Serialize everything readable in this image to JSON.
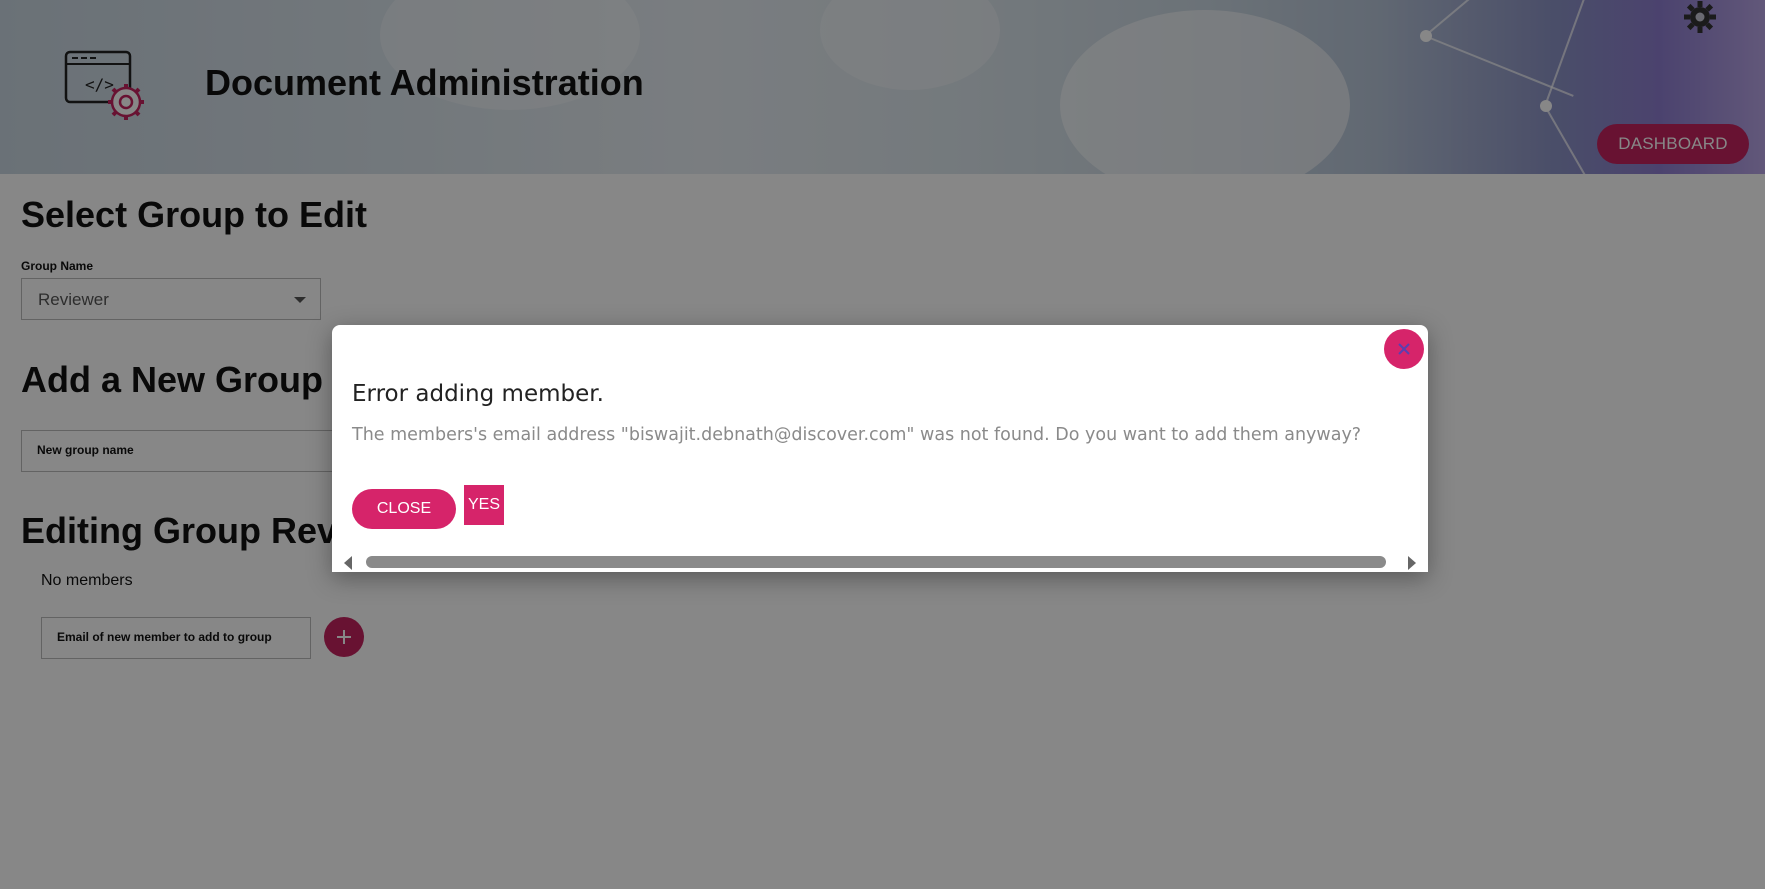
{
  "header": {
    "title": "Document Administration",
    "dashboard_label": "DASHBOARD",
    "logo_icon": "code-window-gear-icon",
    "settings_icon": "gear-icon"
  },
  "main": {
    "select_heading": "Select Group to Edit",
    "group_name_label": "Group Name",
    "group_name_value": "Reviewer",
    "add_heading": "Add a New Group",
    "new_group_placeholder": "New group name",
    "editing_heading": "Editing Group Reviewer",
    "no_members": "No members",
    "new_member_placeholder": "Email of new member to add to group"
  },
  "modal": {
    "title": "Error adding member.",
    "message": "The members's email address \"biswajit.debnath@discover.com\" was not found. Do you want to add them anyway?",
    "close_label": "CLOSE",
    "yes_label": "YES"
  },
  "colors": {
    "accent": "#d6246a",
    "overlay": "rgba(0,0,0,0.47)"
  }
}
